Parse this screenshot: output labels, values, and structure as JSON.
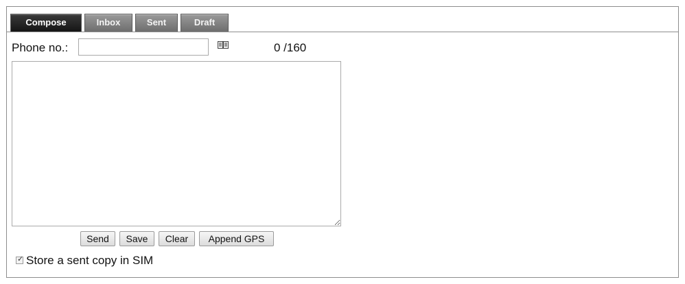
{
  "tabs": [
    {
      "label": "Compose",
      "active": true
    },
    {
      "label": "Inbox",
      "active": false
    },
    {
      "label": "Sent",
      "active": false
    },
    {
      "label": "Draft",
      "active": false
    }
  ],
  "compose": {
    "phone_label": "Phone no.:",
    "phone_value": "",
    "phonebook_icon": "phonebook-icon",
    "char_counter": "0 /160",
    "message_value": ""
  },
  "buttons": {
    "send": "Send",
    "save": "Save",
    "clear": "Clear",
    "append_gps": "Append GPS"
  },
  "options": {
    "store_copy_label": "Store a sent copy in SIM",
    "store_copy_checked": true
  },
  "colors": {
    "active_tab": "#1f1f1f",
    "inactive_tab": "#7f7f7f",
    "border": "#8c8c8c"
  }
}
